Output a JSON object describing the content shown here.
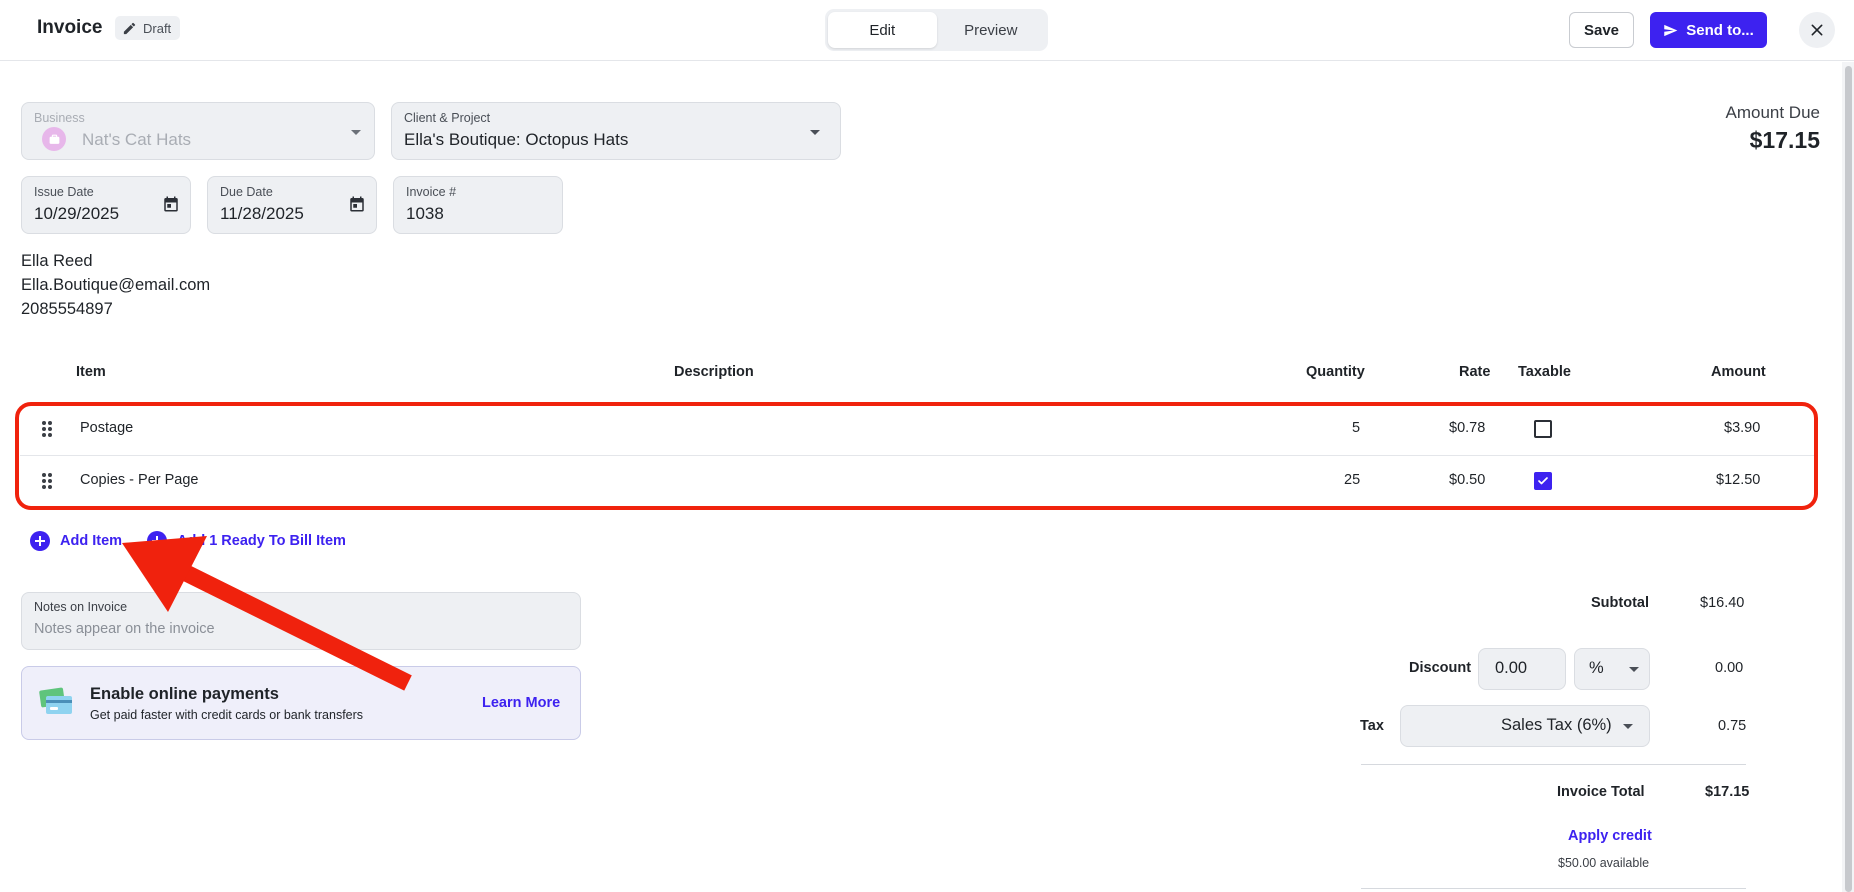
{
  "header": {
    "title": "Invoice",
    "status": "Draft",
    "tabs": [
      {
        "label": "Edit",
        "active": true
      },
      {
        "label": "Preview",
        "active": false
      }
    ],
    "save_label": "Save",
    "send_label": "Send to..."
  },
  "business": {
    "label": "Business",
    "value": "Nat's Cat Hats"
  },
  "client": {
    "label": "Client & Project",
    "value": "Ella's Boutique: Octopus Hats"
  },
  "issue_date": {
    "label": "Issue Date",
    "value": "10/29/2025"
  },
  "due_date": {
    "label": "Due Date",
    "value": "11/28/2025"
  },
  "invoice_number": {
    "label": "Invoice #",
    "value": "1038"
  },
  "amount_due": {
    "label": "Amount Due",
    "value": "$17.15"
  },
  "contact": {
    "name": "Ella Reed",
    "email": "Ella.Boutique@email.com",
    "phone": "2085554897"
  },
  "table": {
    "headers": {
      "item": "Item",
      "description": "Description",
      "quantity": "Quantity",
      "rate": "Rate",
      "taxable": "Taxable",
      "amount": "Amount"
    },
    "rows": [
      {
        "item": "Postage",
        "description": "",
        "quantity": "5",
        "rate": "$0.78",
        "taxable": false,
        "amount": "$3.90"
      },
      {
        "item": "Copies - Per Page",
        "description": "",
        "quantity": "25",
        "rate": "$0.50",
        "taxable": true,
        "amount": "$12.50"
      }
    ]
  },
  "actions": {
    "add_item": "Add Item",
    "add_ready": "Add 1 Ready To Bill Item"
  },
  "notes": {
    "label": "Notes on Invoice",
    "placeholder": "Notes appear on the invoice"
  },
  "payments": {
    "title": "Enable online payments",
    "subtitle": "Get paid faster with credit cards or bank transfers",
    "link": "Learn More"
  },
  "totals": {
    "subtotal_label": "Subtotal",
    "subtotal_value": "$16.40",
    "discount_label": "Discount",
    "discount_input": "0.00",
    "discount_unit": "%",
    "discount_value": "0.00",
    "tax_label": "Tax",
    "tax_select": "Sales Tax (6%)",
    "tax_value": "0.75",
    "total_label": "Invoice Total",
    "total_value": "$17.15",
    "apply_credit": "Apply credit",
    "credit_available": "$50.00 available"
  },
  "colors": {
    "accent": "#3d22f0",
    "annotation": "#f0220d",
    "field_bg": "#eef0f3"
  }
}
